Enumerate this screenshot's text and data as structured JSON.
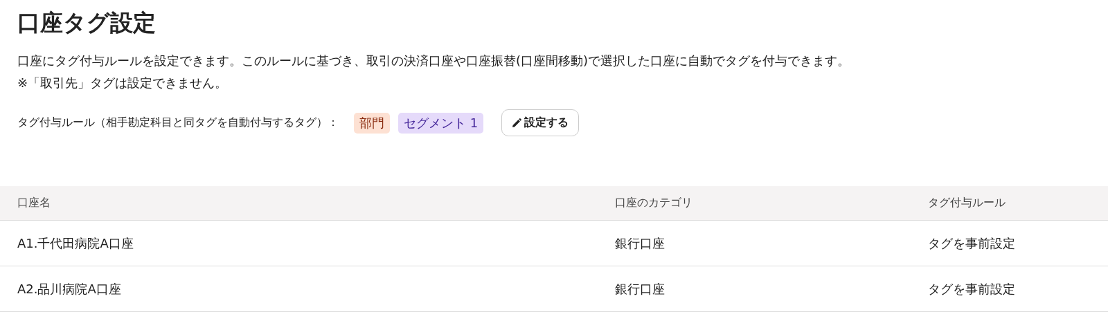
{
  "title": "口座タグ設定",
  "description": [
    "口座にタグ付与ルールを設定できます。このルールに基づき、取引の決済口座や口座振替(口座間移動)で選択した口座に自動でタグを付与できます。",
    "※「取引先」タグは設定できません。"
  ],
  "rule": {
    "label": "タグ付与ルール（相手勘定科目と同タグを自動付与するタグ）：",
    "tags": [
      {
        "label": "部門",
        "color": "#fde1d3"
      },
      {
        "label": "セグメント 1",
        "color": "#e5dafa"
      }
    ],
    "button": "設定する"
  },
  "table": {
    "columns": [
      "口座名",
      "口座のカテゴリ",
      "タグ付与ルール"
    ],
    "rows": [
      [
        "A1.千代田病院A口座",
        "銀行口座",
        "タグを事前設定"
      ],
      [
        "A2.品川病院A口座",
        "銀行口座",
        "タグを事前設定"
      ]
    ]
  }
}
